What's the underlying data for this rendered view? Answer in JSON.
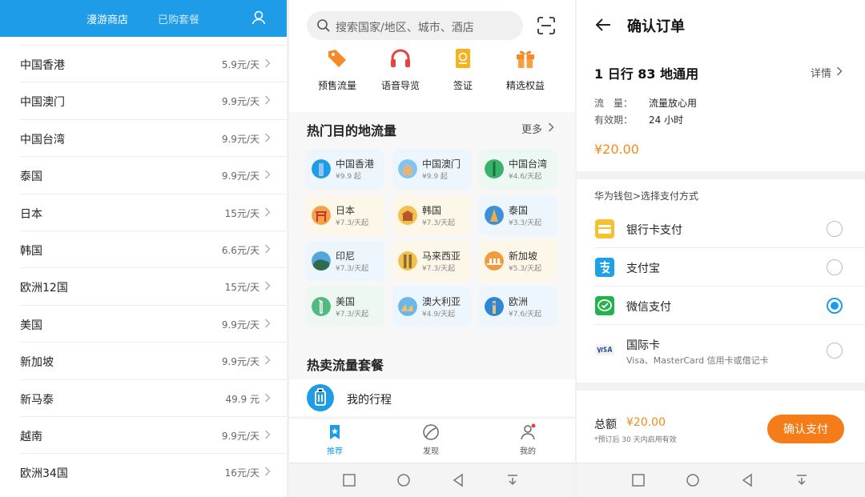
{
  "panel1": {
    "tabs": {
      "active": "漫游商店",
      "inactive": "已购套餐"
    },
    "items": [
      {
        "name": "中国香港",
        "price": "5.9元/天"
      },
      {
        "name": "中国澳门",
        "price": "9.9元/天"
      },
      {
        "name": "中国台湾",
        "price": "9.9元/天"
      },
      {
        "name": "泰国",
        "price": "9.9元/天"
      },
      {
        "name": "日本",
        "price": "15元/天"
      },
      {
        "name": "韩国",
        "price": "6.6元/天"
      },
      {
        "name": "欧洲12国",
        "price": "15元/天"
      },
      {
        "name": "美国",
        "price": "9.9元/天"
      },
      {
        "name": "新加坡",
        "price": "9.9元/天"
      },
      {
        "name": "新马泰",
        "price": "49.9 元"
      },
      {
        "name": "越南",
        "price": "9.9元/天"
      },
      {
        "name": "欧洲34国",
        "price": "16元/天"
      }
    ]
  },
  "panel2": {
    "search_placeholder": "搜索国家/地区、城市、酒店",
    "quick_actions": [
      {
        "label": "预售流量",
        "icon": "tag-icon"
      },
      {
        "label": "语音导览",
        "icon": "headphones-icon"
      },
      {
        "label": "签证",
        "icon": "passport-icon"
      },
      {
        "label": "精选权益",
        "icon": "gift-icon"
      }
    ],
    "hot_title": "热门目的地流量",
    "more": "更多",
    "destinations": [
      {
        "name": "中国香港",
        "price": "¥9.9 起"
      },
      {
        "name": "中国澳门",
        "price": "¥9.9 起"
      },
      {
        "name": "中国台湾",
        "price": "¥4.6/天起"
      },
      {
        "name": "日本",
        "price": "¥7.3/天起"
      },
      {
        "name": "韩国",
        "price": "¥7.3/天起"
      },
      {
        "name": "泰国",
        "price": "¥3.3/天起"
      },
      {
        "name": "印尼",
        "price": "¥7.3/天起"
      },
      {
        "name": "马来西亚",
        "price": "¥7.3/天起"
      },
      {
        "name": "新加坡",
        "price": "¥5.3/天起"
      },
      {
        "name": "美国",
        "price": "¥7.3/天起"
      },
      {
        "name": "澳大利亚",
        "price": "¥4.9/天起"
      },
      {
        "name": "欧洲",
        "price": "¥7.6/天起"
      }
    ],
    "packages_title": "热卖流量套餐",
    "trip_label": "我的行程",
    "tabs": [
      {
        "label": "推荐",
        "active": true
      },
      {
        "label": "发现",
        "active": false
      },
      {
        "label": "我的",
        "active": false
      }
    ]
  },
  "panel3": {
    "title": "确认订单",
    "plan": "1 日行 83 地通用",
    "detail": "详情",
    "flow_key": "流　量：",
    "flow_value": "流量放心用",
    "validity_key": "有效期：",
    "validity_value": "24 小时",
    "price": "¥20.00",
    "pay_method_title": "华为钱包>选择支付方式",
    "methods": [
      {
        "label": "银行卡支付",
        "sub": "",
        "icon": "bank-card-icon",
        "selected": false
      },
      {
        "label": "支付宝",
        "sub": "",
        "icon": "alipay-icon",
        "selected": false
      },
      {
        "label": "微信支付",
        "sub": "",
        "icon": "wechat-pay-icon",
        "selected": true
      },
      {
        "label": "国际卡",
        "sub": "Visa、MasterCard 信用卡或借记卡",
        "icon": "visa-icon",
        "selected": false
      }
    ],
    "total_label": "总额",
    "total_amount": "¥20.00",
    "total_note": "*预订后 30 天内启用有效",
    "pay_button": "确认支付"
  },
  "colors": {
    "brand_blue": "#1f9ce8",
    "orange": "#f47d1a",
    "price_orange": "#f18b1e"
  }
}
